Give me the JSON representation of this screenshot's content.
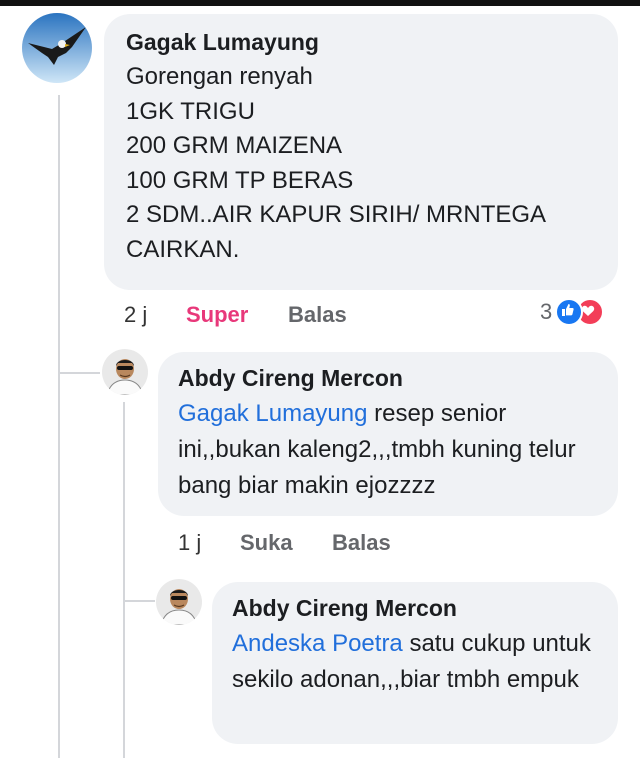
{
  "comments": [
    {
      "author": "Gagak Lumayung",
      "text_lines": "Gorengan renyah\n1GK TRIGU\n200 GRM MAIZENA\n100 GRM TP BERAS\n2 SDM..AIR KAPUR SIRIH/ MRNTEGA\nCAIRKAN.",
      "time": "2 j",
      "reaction_label": "Super",
      "reply_label": "Balas",
      "reaction_count": "3",
      "reaction_icons": [
        "like-icon",
        "love-icon"
      ],
      "colors": {
        "reaction_active": "#e8387a"
      }
    },
    {
      "author": "Abdy Cireng Mercon",
      "mention": "Gagak Lumayung",
      "text": " resep senior ini,,bukan kaleng2,,,tmbh kuning telur bang biar makin ejozzzz",
      "time": "1 j",
      "like_label": "Suka",
      "reply_label": "Balas"
    },
    {
      "author": "Abdy Cireng Mercon",
      "mention": "Andeska Poetra",
      "text": " satu cukup untuk sekilo adonan,,,biar tmbh empuk"
    }
  ],
  "colors": {
    "bubble": "#f0f2f5",
    "mention": "#216fdb",
    "meta": "#65676b"
  }
}
